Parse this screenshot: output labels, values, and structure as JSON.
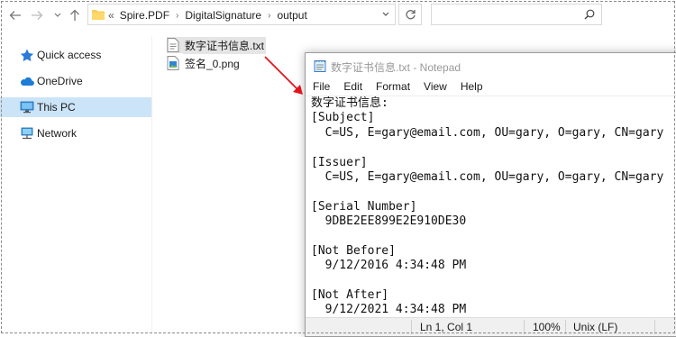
{
  "explorer": {
    "breadcrumbs": [
      "Spire.PDF",
      "DigitalSignature",
      "output"
    ],
    "crumb_prefix": "«",
    "nav": [
      {
        "label": "Quick access",
        "icon": "star-icon"
      },
      {
        "label": "OneDrive",
        "icon": "cloud-icon"
      },
      {
        "label": "This PC",
        "icon": "computer-icon",
        "selected": true
      },
      {
        "label": "Network",
        "icon": "network-icon"
      }
    ],
    "files": [
      {
        "name": "数字证书信息.txt",
        "type": "text-file-icon",
        "selected": true
      },
      {
        "name": "签名_0.png",
        "type": "image-file-icon",
        "selected": false
      }
    ]
  },
  "notepad": {
    "title": "数字证书信息.txt - Notepad",
    "menu": [
      "File",
      "Edit",
      "Format",
      "View",
      "Help"
    ],
    "lines": [
      "数字证书信息:",
      "[Subject]",
      "  C=US, E=gary@email.com, OU=gary, O=gary, CN=gary",
      "",
      "[Issuer]",
      "  C=US, E=gary@email.com, OU=gary, O=gary, CN=gary",
      "",
      "[Serial Number]",
      "  9DBE2EE899E2E910DE30",
      "",
      "[Not Before]",
      "  9/12/2016 4:34:48 PM",
      "",
      "[Not After]",
      "  9/12/2021 4:34:48 PM"
    ],
    "status": {
      "position": "Ln 1, Col 1",
      "zoom": "100%",
      "line_ending": "Unix (LF)"
    }
  },
  "colors": {
    "selection": "#cce4f7",
    "arrow": "#e0151b",
    "folder": "#f7cf5e"
  }
}
